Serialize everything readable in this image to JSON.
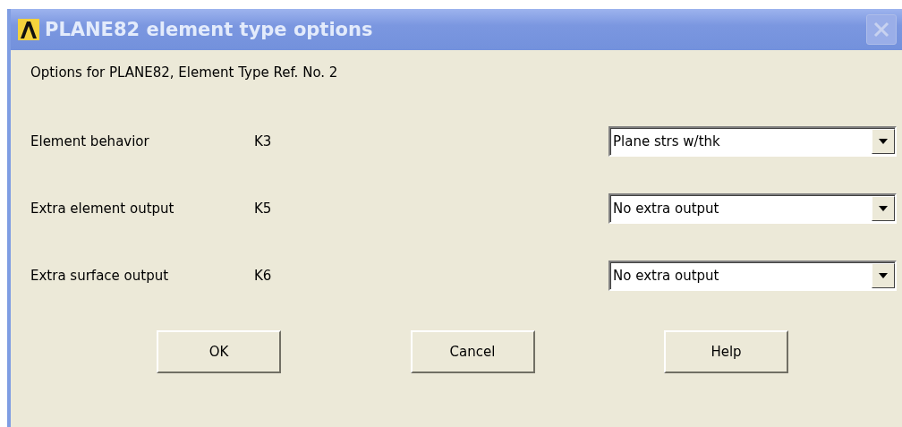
{
  "window": {
    "title": "PLANE82 element type options"
  },
  "header": "Options for PLANE82, Element Type Ref. No. 2",
  "options": [
    {
      "label": "Element behavior",
      "key": "K3",
      "value": "Plane strs w/thk"
    },
    {
      "label": "Extra element output",
      "key": "K5",
      "value": "No extra output"
    },
    {
      "label": "Extra surface output",
      "key": "K6",
      "value": "No extra output"
    }
  ],
  "buttons": [
    "OK",
    "Cancel",
    "Help"
  ]
}
